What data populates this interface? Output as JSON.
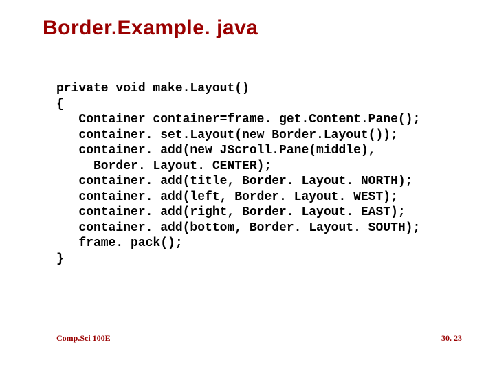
{
  "title": "Border.Example. java",
  "code": "private void make.Layout()\n{\n   Container container=frame. get.Content.Pane();\n   container. set.Layout(new Border.Layout());\n   container. add(new JScroll.Pane(middle),\n     Border. Layout. CENTER);\n   container. add(title, Border. Layout. NORTH);\n   container. add(left, Border. Layout. WEST);\n   container. add(right, Border. Layout. EAST);\n   container. add(bottom, Border. Layout. SOUTH);\n   frame. pack();\n}",
  "footer": {
    "left": "Comp.Sci 100E",
    "right": "30. 23"
  }
}
